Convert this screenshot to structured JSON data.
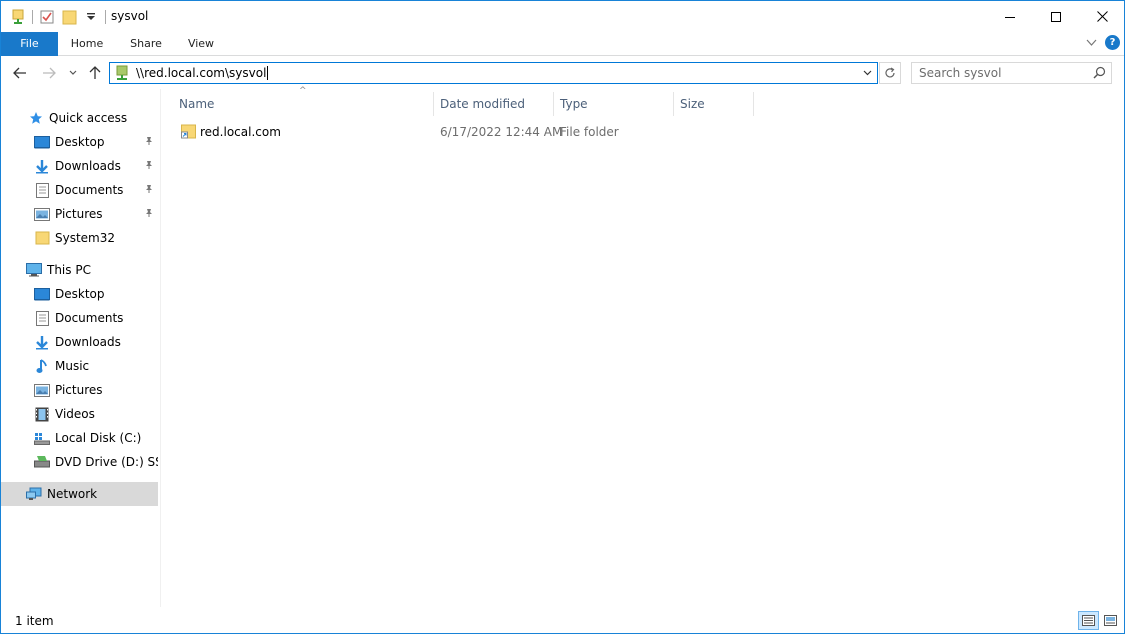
{
  "window": {
    "title": "sysvol"
  },
  "ribbon": {
    "tabs": [
      "File",
      "Home",
      "Share",
      "View"
    ]
  },
  "address": {
    "path": "\\\\red.local.com\\sysvol"
  },
  "search": {
    "placeholder": "Search sysvol"
  },
  "nav": {
    "quick_access": "Quick access",
    "quick_items": [
      "Desktop",
      "Downloads",
      "Documents",
      "Pictures",
      "System32"
    ],
    "this_pc": "This PC",
    "pc_items": [
      "Desktop",
      "Documents",
      "Downloads",
      "Music",
      "Pictures",
      "Videos",
      "Local Disk (C:)",
      "DVD Drive (D:) SSS_X"
    ],
    "network": "Network"
  },
  "columns": [
    "Name",
    "Date modified",
    "Type",
    "Size"
  ],
  "files": [
    {
      "name": "red.local.com",
      "date": "6/17/2022 12:44 AM",
      "type": "File folder",
      "size": ""
    }
  ],
  "status": {
    "count": "1 item"
  },
  "colors": {
    "accent": "#1979ca",
    "selected": "#d9d9d9",
    "header_text": "#4c607a",
    "folder": "#f8d775"
  }
}
